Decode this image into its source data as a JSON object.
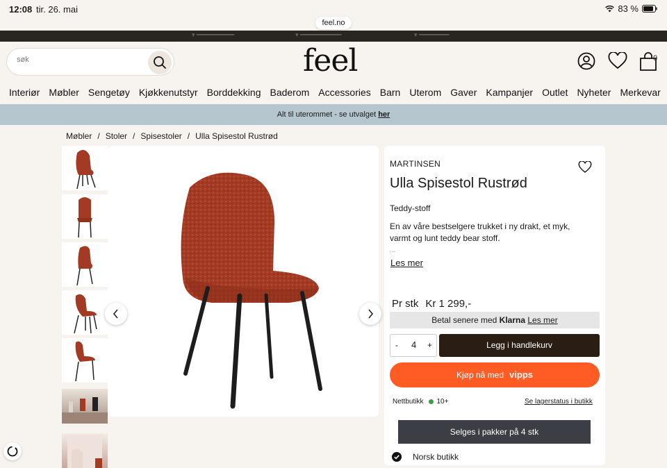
{
  "status": {
    "time": "12:08",
    "date": "tir. 26. mai",
    "battery": "83 %"
  },
  "browser": {
    "url": "feel.no"
  },
  "header": {
    "logo": "feel",
    "search_placeholder": "søk",
    "cart_count": "0"
  },
  "nav": [
    "Interiør",
    "Møbler",
    "Sengetøy",
    "Kjøkkenutstyr",
    "Borddekking",
    "Baderom",
    "Accessories",
    "Barn",
    "Uterom",
    "Gaver",
    "Kampanjer",
    "Outlet",
    "Nyheter",
    "Merkevar"
  ],
  "promo": {
    "text": "Alt til uterommet - se utvalget ",
    "link": "her"
  },
  "breadcrumb": [
    "Møbler",
    "/",
    "Stoler",
    "/",
    "Spisestoler",
    "/",
    "Ulla Spisestol Rustrød"
  ],
  "product": {
    "brand": "MARTINSEN",
    "title": "Ulla Spisestol Rustrød",
    "material": "Teddy-stoff",
    "description": "En av våre bestselgere trukket i ny drakt, et myk, varmt og lunt teddy bear stoff.",
    "ellipsis": "...",
    "read_more": "Les mer",
    "price_unit": "Pr stk",
    "price": "Kr 1 299,-",
    "klarna_prefix": "Betal senere med",
    "klarna_brand": "Klarna",
    "klarna_link": "Les mer",
    "quantity": "4",
    "qty_minus": "-",
    "qty_plus": "+",
    "add_to_cart": "Legg i handlekurv",
    "vipps_prefix": "Kjøp nå med",
    "vipps_brand": "vipps",
    "online_label": "Nettbutikk",
    "online_stock": "10+",
    "store_stock_link": "Se lagerstatus i butikk",
    "package_button": "Selges i pakker på 4 stk",
    "usp": "Norsk butikk"
  },
  "colors": {
    "accent_cart": "#2a1e14",
    "vipps": "#ff5b24",
    "promo_bg": "#b5c6cf",
    "chair": "#a33b24"
  },
  "icons": [
    "search-icon",
    "user-icon",
    "heart-icon",
    "cart-icon",
    "chevron-left-icon",
    "chevron-right-icon",
    "check-circle-icon",
    "wifi-icon",
    "battery-icon",
    "rotate-icon"
  ]
}
